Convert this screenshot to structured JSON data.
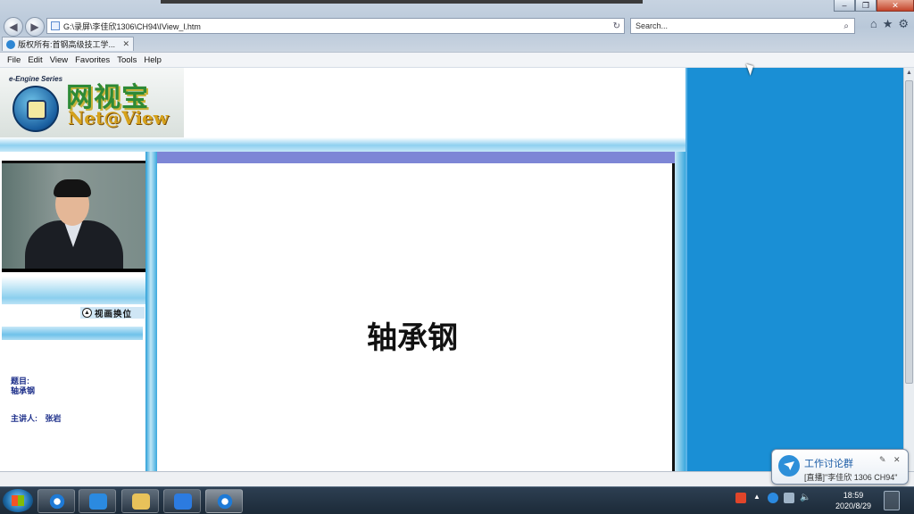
{
  "browser": {
    "address_url": "G:\\录屏\\李佳欣1306\\CH94\\IView_l.htm",
    "search_placeholder": "Search...",
    "tab_title": "版权所有:首钢高级技工学...",
    "menu": [
      "File",
      "Edit",
      "View",
      "Favorites",
      "Tools",
      "Help"
    ]
  },
  "logo": {
    "tagline": "e-Engine Series",
    "cn_name": "网视宝",
    "en_name": "Net@View"
  },
  "player": {
    "swap_label": "视画换位",
    "subject_label": "题目:",
    "subject_value": "轴承钢",
    "lecturer_label": "主讲人:",
    "lecturer_name": "张岩"
  },
  "slide": {
    "title": "轴承钢"
  },
  "taskbar": {
    "time": "18:59",
    "date": "2020/8/29"
  },
  "notification": {
    "title": "工作讨论群",
    "message": "[直播]\"李佳欣 1306 CH94\""
  },
  "colors": {
    "right_panel": "#1a8fd5",
    "slide_header": "#7d86d6",
    "label_blue": "#1d2f8a"
  }
}
